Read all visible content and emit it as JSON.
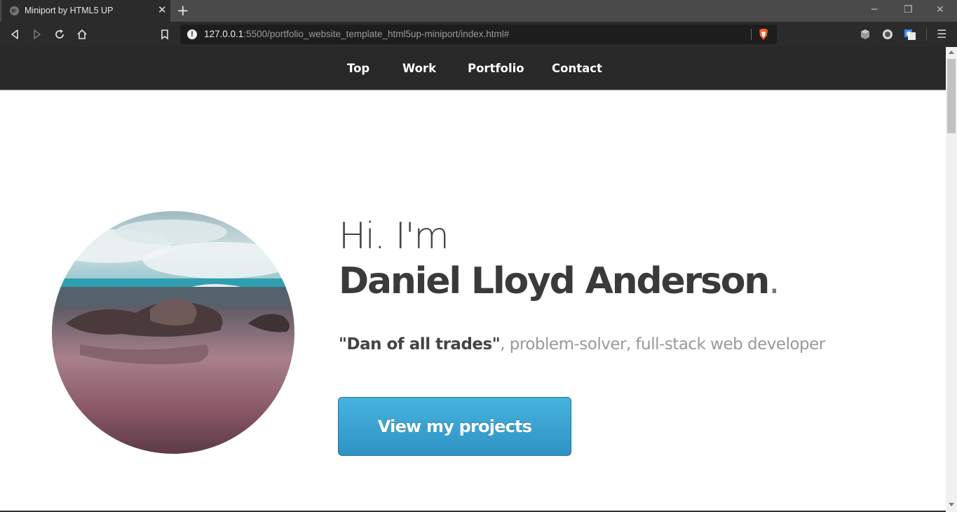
{
  "browser": {
    "tab_title": "Miniport by HTML5 UP",
    "tab_close": "✕",
    "new_tab": "+",
    "url_host": "127.0.0.1",
    "url_rest": ":5500/portfolio_website_template_html5up-miniport/index.html#",
    "icons": [
      "globe-icon",
      "back-icon",
      "forward-icon",
      "reload-icon",
      "home-icon",
      "bookmark-icon",
      "site-info-icon",
      "brave-shield-icon",
      "extension-icons",
      "menu-icon"
    ],
    "window_controls": {
      "minimize": "─",
      "restore": "❐",
      "close": "✕"
    },
    "menu_glyph": "☰",
    "info_glyph": "!"
  },
  "site": {
    "nav": [
      "Top",
      "Work",
      "Portfolio",
      "Contact"
    ],
    "hero": {
      "greeting": "Hi. I'm",
      "name": "Daniel Lloyd Anderson",
      "name_suffix": ".",
      "tagline_strong": "\"Dan of all trades\"",
      "tagline_rest": ", problem-solver, full-stack web developer",
      "cta": "View my projects"
    },
    "colors": {
      "nav_bg": "#282828",
      "cta": "#3aa7d8",
      "text_dark": "#3a3a3a",
      "text_light": "#999999"
    }
  }
}
